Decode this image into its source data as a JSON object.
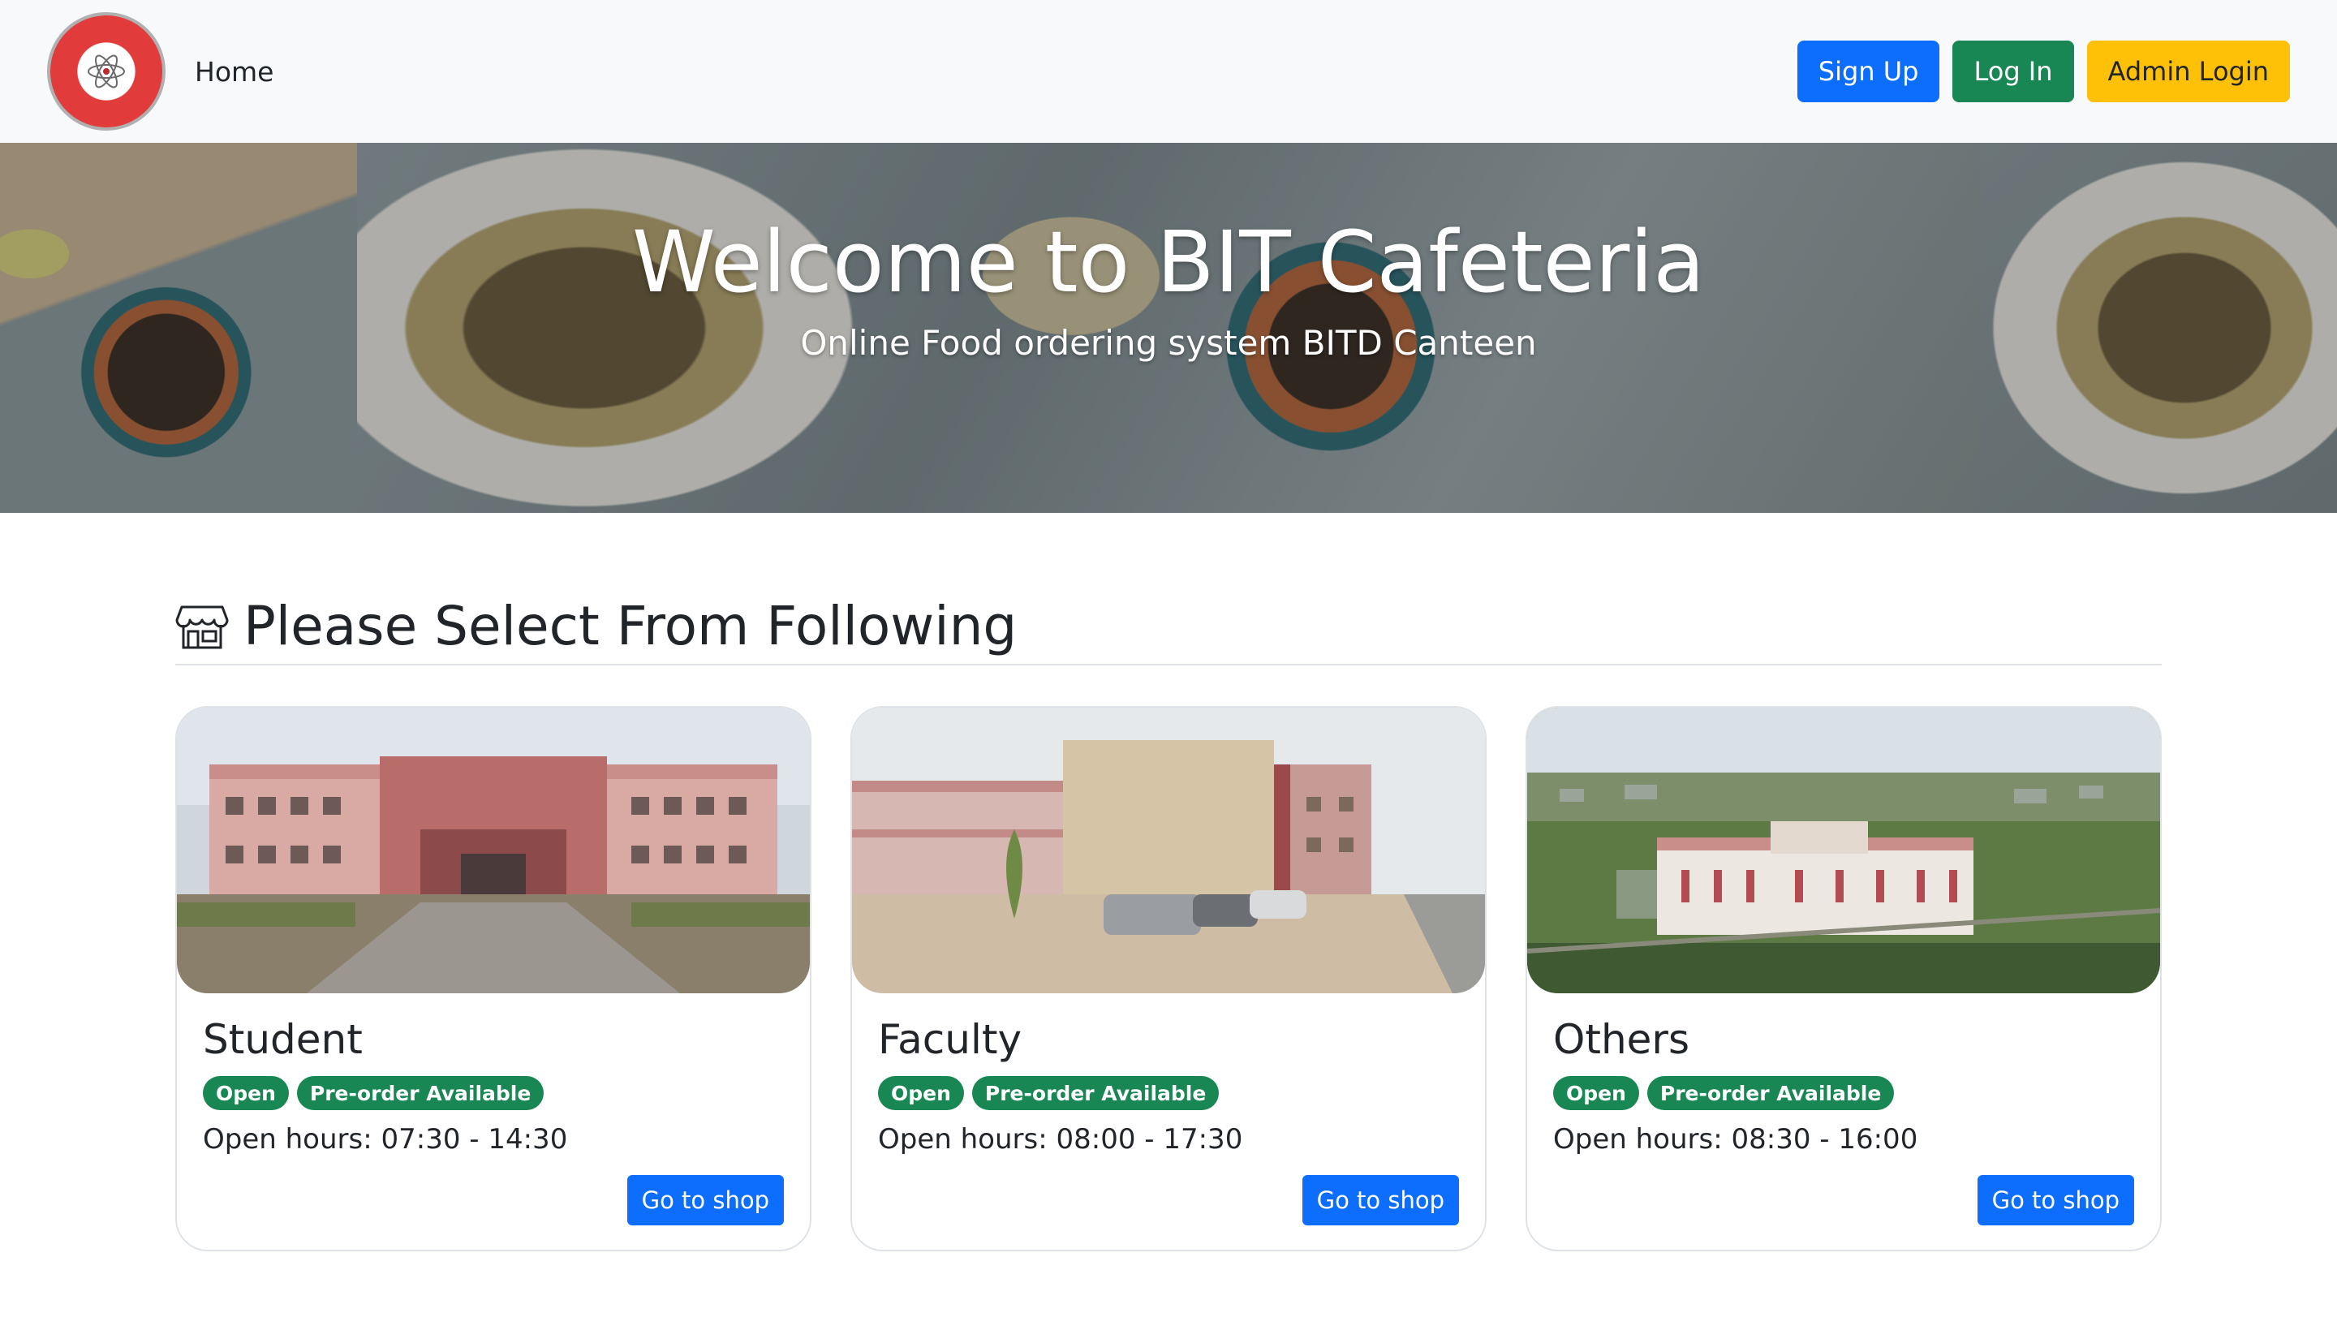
{
  "navbar": {
    "logo_icon": "college-seal-icon",
    "home_link": "Home",
    "signup_label": "Sign Up",
    "login_label": "Log In",
    "admin_login_label": "Admin Login"
  },
  "hero": {
    "title": "Welcome to BIT Cafeteria",
    "subtitle": "Online Food ordering system BITD Canteen"
  },
  "section": {
    "icon": "shop-icon",
    "title": "Please Select From Following"
  },
  "cards": [
    {
      "title": "Student",
      "badges": [
        "Open",
        "Pre-order Available"
      ],
      "hours": "Open hours: 07:30 - 14:30",
      "button": "Go to shop"
    },
    {
      "title": "Faculty",
      "badges": [
        "Open",
        "Pre-order Available"
      ],
      "hours": "Open hours: 08:00 - 17:30",
      "button": "Go to shop"
    },
    {
      "title": "Others",
      "badges": [
        "Open",
        "Pre-order Available"
      ],
      "hours": "Open hours: 08:30 - 16:00",
      "button": "Go to shop"
    }
  ],
  "colors": {
    "primary": "#0d6efd",
    "success": "#198754",
    "warning": "#ffc107",
    "navbar_bg": "#f8f9fa"
  }
}
